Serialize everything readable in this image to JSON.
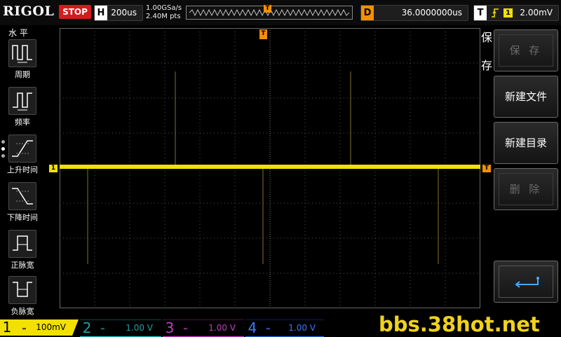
{
  "brand": "RIGOL",
  "run_state": "STOP",
  "horizontal": {
    "tag": "H",
    "timebase": "200us"
  },
  "acquisition": {
    "sample_rate": "1.00GSa/s",
    "memory_depth": "2.40M pts"
  },
  "trigger_marker": "T",
  "delay": {
    "tag": "D",
    "value": "36.0000000us"
  },
  "trigger": {
    "tag": "T",
    "source": "1",
    "level": "2.00mV",
    "slope_icon": "rising-edge-icon"
  },
  "left_menu": {
    "title": "水 平",
    "items": [
      {
        "label": "周期",
        "icon": "period-icon"
      },
      {
        "label": "频率",
        "icon": "frequency-icon"
      },
      {
        "label": "上升时间",
        "icon": "rise-time-icon"
      },
      {
        "label": "下降时间",
        "icon": "fall-time-icon"
      },
      {
        "label": "正脉宽",
        "icon": "positive-width-icon"
      },
      {
        "label": "负脉宽",
        "icon": "negative-width-icon"
      }
    ]
  },
  "right_menu": {
    "title_1": "保",
    "title_2": "存",
    "buttons": [
      {
        "label": "保 存",
        "enabled": false
      },
      {
        "label": "新建文件",
        "enabled": true
      },
      {
        "label": "新建目录",
        "enabled": true
      },
      {
        "label": "删 除",
        "enabled": false
      }
    ],
    "enter_icon": "enter-arrow-icon"
  },
  "channels": [
    {
      "num": "1",
      "scale": "100mV",
      "active": true,
      "color": "#f2e100"
    },
    {
      "num": "2",
      "scale": "1.00 V",
      "active": false,
      "color": "#1fd0d0"
    },
    {
      "num": "3",
      "scale": "1.00 V",
      "active": false,
      "color": "#e040e0"
    },
    {
      "num": "4",
      "scale": "1.00 V",
      "active": false,
      "color": "#2a70ff"
    }
  ],
  "trace": {
    "channel": "1",
    "color": "#f2e100",
    "marker_label": "1",
    "trigger_label": "T"
  },
  "watermark": "bbs.38hot.net",
  "colors": {
    "accent_orange": "#f39000",
    "stop_red": "#d41c1c",
    "trace_yellow": "#f2e100",
    "grid": "#555555"
  }
}
